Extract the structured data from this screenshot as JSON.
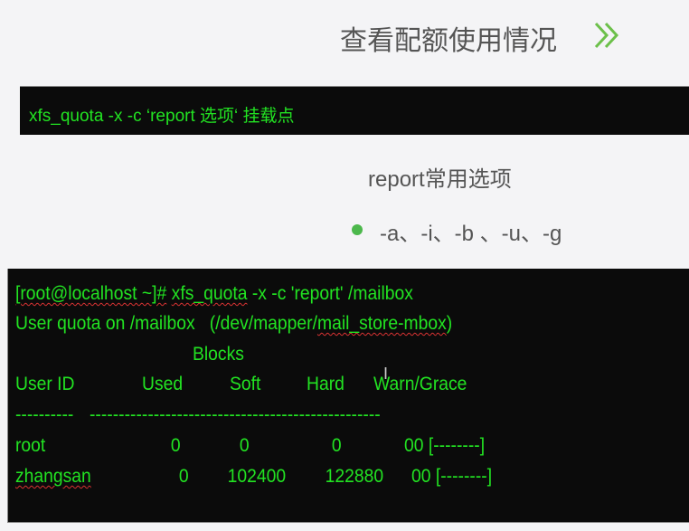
{
  "slide": {
    "title": "查看配额使用情况",
    "title_icon": "double-chevron-right-icon",
    "accent_color": "#6cc04a",
    "syntax": "xfs_quota -x -c ‘report 选项‘ 挂载点",
    "options_title": "report常用选项",
    "options": "-a、-i、-b 、-u、-g"
  },
  "terminal": {
    "prompt": "[root@localhost ~]#",
    "command_name": "xfs_quota",
    "command_args": "-x -c 'report' /mailbox",
    "header_prefix": "User quota on /mailbox   (/dev/mapper/",
    "header_device": "mail_store-mbox",
    "header_suffix": ")",
    "group_label": "Blocks",
    "columns": [
      "User ID",
      "Used",
      "Soft",
      "Hard",
      "Warn/Grace"
    ],
    "separator_short": "----------",
    "separator_long": "--------------------------------------------------",
    "rows": [
      {
        "user": "root",
        "used": "0",
        "soft": "0",
        "hard": "0",
        "warn_grace": "00 [--------]"
      },
      {
        "user": "zhangsan",
        "used": "0",
        "soft": "102400",
        "hard": "122880",
        "warn_grace": "00 [--------]"
      }
    ],
    "text_color": "#22e322"
  }
}
